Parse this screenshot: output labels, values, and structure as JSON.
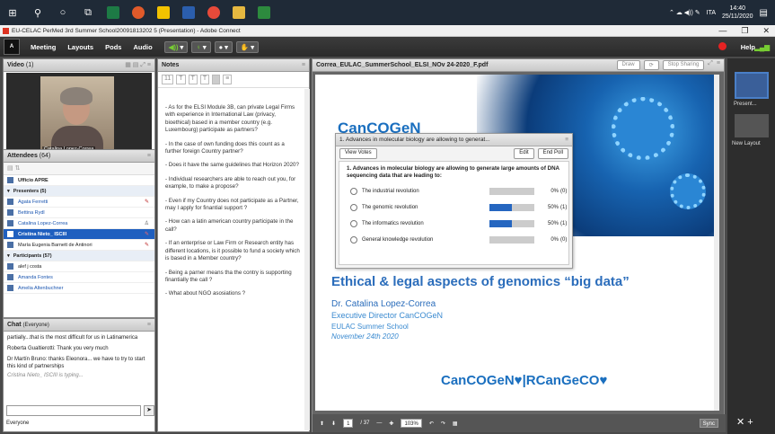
{
  "taskbar": {
    "tray_lang": "ITA",
    "time": "14:40",
    "date": "25/11/2020"
  },
  "window": {
    "title": "EU-CELAC PerMed 3rd Summer School20091813202 5 (Presentation) - Adobe Connect",
    "min": "—",
    "max": "❐",
    "close": "✕"
  },
  "menu": {
    "items": [
      "Meeting",
      "Layouts",
      "Pods",
      "Audio"
    ],
    "help": "Help"
  },
  "video": {
    "title": "Video",
    "count": "(1)",
    "name": "Catalina Lopez-Correa"
  },
  "attendees": {
    "title": "Attendees",
    "count": "(64)",
    "host": "Ufficio APRE",
    "presenters_header": "Presenters (5)",
    "presenters": [
      "Agata Ferretti",
      "Bettina Rydl",
      "Catalina Lopez-Correa",
      "Cristina Nieto_ ISCIII",
      "María Eugenia Barnett de Antinori"
    ],
    "participants_header": "Participants (57)",
    "participants": [
      "alef j costa",
      "Amanda Fontes",
      "Amelia Altenbuchner"
    ]
  },
  "chat": {
    "title": "Chat",
    "scope": "(Everyone)",
    "messages": [
      "partially...that is the most difficult for us in Latinamerica",
      "Roberta Gualtierotti: Thank you very much",
      "Dr Martín Bruno: thanks Eleonora... we have to try to start this kind of partnerships"
    ],
    "typing": "Cristina Nieto_ ISCIII is typing...",
    "recipient": "Everyone"
  },
  "notes": {
    "title": "Notes",
    "font_size": "11",
    "paragraphs": [
      "- As for the ELSI Module 3B, can private Legal Firms with experience in International Law (privacy, bioethical) based in a member country (e.g. Luxembourg) participate as partners?",
      "- In the case of own funding does this count as a further foreign Country partner?",
      "- Does it have the same guidelines that Horizon 2020?",
      "- Individual researchers are able to reach out you, for example, to make a propose?",
      "- Even if my Country does not participate as a Partner, may I apply for finantial support ?",
      "- How can a latin american country participate in the call?",
      "- If an enterprise or Law Firm or Research entity has different locations, is it possible to fund a society which is based in a Member country?",
      "- Being a parner means tha the contry is supporting finantially the call ?",
      "- What about NGO asosiations ?"
    ]
  },
  "share": {
    "title": "Correa_EULAC_SummerSchool_ELSI_NOv 24-2020_F.pdf",
    "draw": "Draw",
    "stop": "Stop Sharing",
    "slide": {
      "logo": "CanCOGeN",
      "heading": "Ethical & legal aspects of genomics “big data”",
      "presenter": "Dr. Catalina Lopez-Correa",
      "role": "Executive Director CanCOGeN",
      "event": "EULAC Summer School",
      "date": "November 24th 2020",
      "footer": "CanCOGeN♥|RCanGeCO♥"
    },
    "page": "1",
    "pages": "/ 37",
    "zoom": "103%",
    "sync": "Sync"
  },
  "poll": {
    "title": "1. Advances in molecular biology are allowing to generat...",
    "view_votes": "View Votes",
    "edit": "Edit",
    "end": "End Poll",
    "question": "1. Advances in molecular biology are allowing to generate large amounts of DNA sequencing data that are leading to:",
    "options": [
      {
        "label": "The industrial revolution",
        "pct": "0%",
        "count": "(0)",
        "value": 0
      },
      {
        "label": "The genomic revolution",
        "pct": "50%",
        "count": "(1)",
        "value": 0.5
      },
      {
        "label": "The informatics revolution",
        "pct": "50%",
        "count": "(1)",
        "value": 0.5
      },
      {
        "label": "General knowledge revolution",
        "pct": "0%",
        "count": "(0)",
        "value": 0
      }
    ]
  },
  "side": {
    "presenter": "Present...",
    "new_layout": "New Layout"
  },
  "colors": {
    "accent_blue": "#1f5fbf",
    "slide_blue": "#1a6fbf",
    "red": "#d0202a"
  }
}
